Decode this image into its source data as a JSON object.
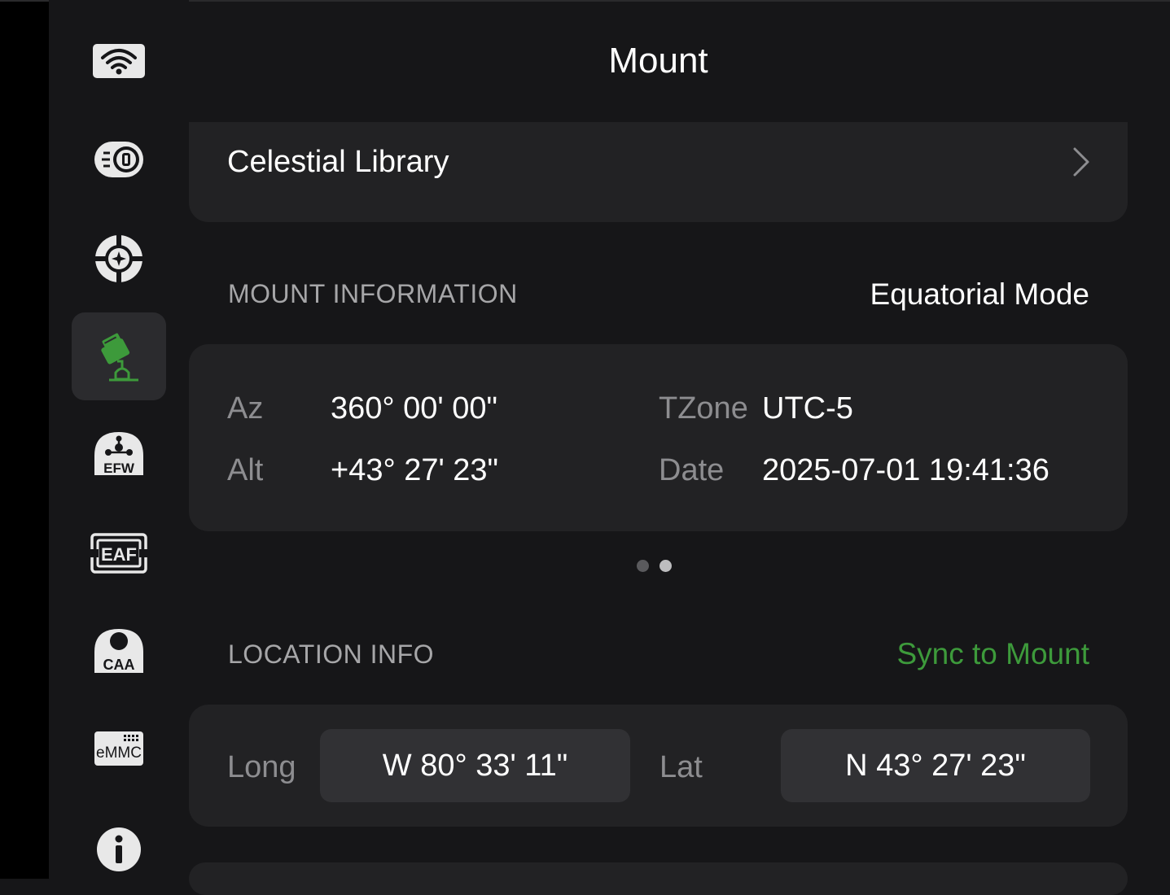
{
  "header": {
    "title": "Mount"
  },
  "sidebar": {
    "items": [
      {
        "icon": "wifi-icon",
        "active": false
      },
      {
        "icon": "camera-icon",
        "active": false
      },
      {
        "icon": "guide-crosshair-icon",
        "active": false
      },
      {
        "icon": "mount-icon",
        "active": true
      },
      {
        "icon": "efw-icon",
        "label": "EFW",
        "active": false
      },
      {
        "icon": "eaf-icon",
        "label": "EAF",
        "active": false
      },
      {
        "icon": "caa-icon",
        "label": "CAA",
        "active": false
      },
      {
        "icon": "emmc-icon",
        "label": "eMMC",
        "active": false
      },
      {
        "icon": "info-icon",
        "active": false
      }
    ]
  },
  "celestial_library": {
    "label": "Celestial Library"
  },
  "mount_info": {
    "section_title": "MOUNT INFORMATION",
    "mode": "Equatorial Mode",
    "az_label": "Az",
    "az_value": "360° 00' 00\"",
    "alt_label": "Alt",
    "alt_value": "+43° 27' 23\"",
    "tzone_label": "TZone",
    "tzone_value": "UTC-5",
    "date_label": "Date",
    "date_value": "2025-07-01 19:41:36",
    "pager": {
      "pages": 2,
      "current": 2
    }
  },
  "location": {
    "section_title": "LOCATION INFO",
    "sync_label": "Sync to Mount",
    "long_label": "Long",
    "long_value": "W 80° 33' 11\"",
    "lat_label": "Lat",
    "lat_value": "N 43° 27' 23\""
  },
  "colors": {
    "accent_green": "#3d9a3b",
    "background": "#161618",
    "card": "#222224",
    "field": "#313134",
    "muted_text": "#8d8d90"
  }
}
